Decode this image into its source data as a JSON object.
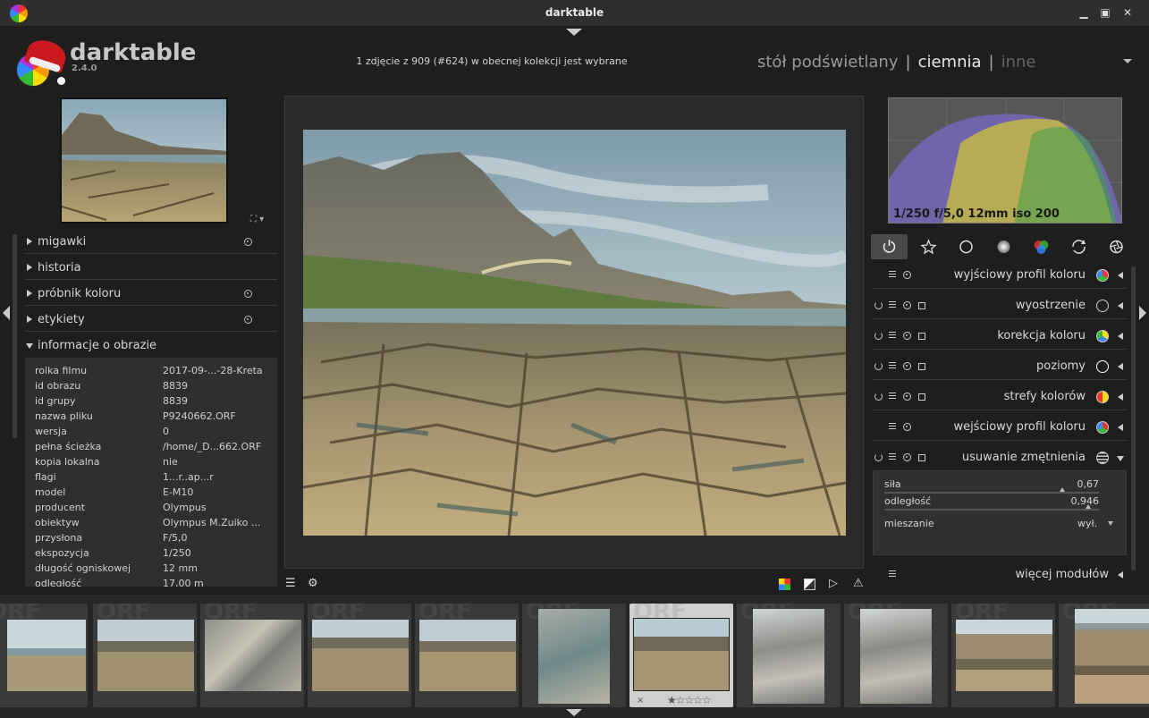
{
  "window": {
    "title": "darktable"
  },
  "header": {
    "app_name": "darktable",
    "version": "2.4.0",
    "selection_info": "1 zdjęcie z 909 (#624) w obecnej kolekcji jest wybrane",
    "views": [
      "stół podświetlany",
      "ciemnia",
      "inne"
    ],
    "views_sep": "|",
    "active_view": "ciemnia"
  },
  "left_modules": [
    {
      "label": "migawki",
      "has_preset": true
    },
    {
      "label": "historia",
      "has_preset": false
    },
    {
      "label": "próbnik koloru",
      "has_preset": true
    },
    {
      "label": "etykiety",
      "has_preset": true
    },
    {
      "label": "informacje o obrazie",
      "has_preset": false,
      "expanded": true
    }
  ],
  "image_info": [
    {
      "key": "rolka filmu",
      "value": "2017-09-...-28-Kreta"
    },
    {
      "key": "id obrazu",
      "value": "8839"
    },
    {
      "key": "id grupy",
      "value": "8839"
    },
    {
      "key": "nazwa pliku",
      "value": "P9240662.ORF"
    },
    {
      "key": "wersja",
      "value": "0"
    },
    {
      "key": "pełna ścieżka",
      "value": "/home/_D...662.ORF"
    },
    {
      "key": "kopia lokalna",
      "value": "nie"
    },
    {
      "key": "flagi",
      "value": "1...r..ap...r"
    },
    {
      "key": "model",
      "value": "E-M10"
    },
    {
      "key": "producent",
      "value": "Olympus"
    },
    {
      "key": "obiektyw",
      "value": "Olympus M.Zuiko ..."
    },
    {
      "key": "przysłona",
      "value": "F/5,0"
    },
    {
      "key": "ekspozycja",
      "value": "1/250"
    },
    {
      "key": "długość ogniskowej",
      "value": "12 mm"
    },
    {
      "key": "odległość",
      "value": "17,00 m"
    }
  ],
  "histogram": {
    "exif_line": "1/250 f/5,0 12mm iso 200"
  },
  "module_groups": [
    "power-icon",
    "star-icon",
    "circle-icon",
    "sphere-icon",
    "color-icon",
    "refresh-icon",
    "aperture-icon"
  ],
  "right_modules": [
    {
      "name": "wyjściowy profil koloru",
      "icon": "profile-icon",
      "color": "#6aa84f",
      "controls": [
        "preset",
        "menu"
      ]
    },
    {
      "name": "wyostrzenie",
      "icon": "sharpen-icon",
      "color": "#cccccc",
      "controls": [
        "power",
        "menu",
        "preset",
        "multi"
      ]
    },
    {
      "name": "korekcja koloru",
      "icon": "color-correction-icon",
      "color": "#d4a017",
      "controls": [
        "power",
        "menu",
        "preset",
        "multi"
      ]
    },
    {
      "name": "poziomy",
      "icon": "levels-icon",
      "color": "#ffffff",
      "controls": [
        "power",
        "menu",
        "preset",
        "multi"
      ]
    },
    {
      "name": "strefy kolorów",
      "icon": "color-zones-icon",
      "color": "#e0b020",
      "controls": [
        "power",
        "menu",
        "preset",
        "multi"
      ]
    },
    {
      "name": "wejściowy profil koloru",
      "icon": "profile-icon",
      "color": "#6aa84f",
      "controls": [
        "preset",
        "menu"
      ]
    },
    {
      "name": "usuwanie zmętnienia",
      "icon": "haze-icon",
      "color": "#cccccc",
      "controls": [
        "power",
        "menu",
        "preset",
        "multi"
      ],
      "expanded": true
    }
  ],
  "dehaze": {
    "strength_label": "siła",
    "strength_value": "0,67",
    "strength_fraction": 0.83,
    "distance_label": "odległość",
    "distance_value": "0,946",
    "distance_fraction": 0.95,
    "blend_label": "mieszanie",
    "blend_value": "wył."
  },
  "more_modules": "więcej modułów",
  "filmstrip": {
    "extension_watermark": "ORF",
    "current_index": 6,
    "star_glyphs": "★☆☆☆☆",
    "reject_glyph": "×"
  },
  "colors": {
    "accent_bg": "#1e1e1e",
    "panel": "#2f2f2f",
    "active_tab": "#4a4a4a"
  }
}
